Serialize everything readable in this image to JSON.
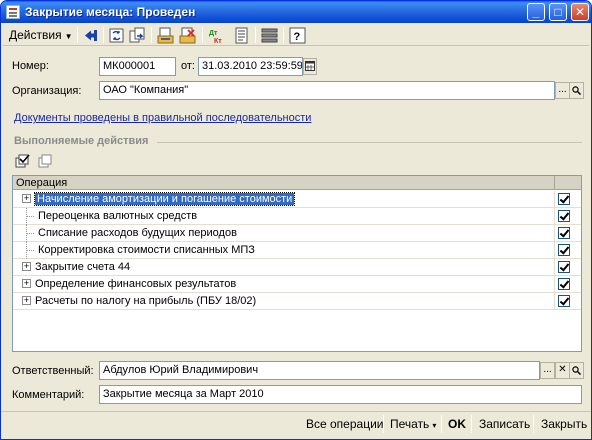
{
  "window": {
    "title": "Закрытие месяца: Проведен",
    "minimize": "_",
    "maximize": "□",
    "close": "✕"
  },
  "toolbar": {
    "actions_label": "Действия",
    "icons": [
      "back-arrow-icon",
      "refresh-icon",
      "replace-icon",
      "post-document-icon",
      "unpost-document-icon",
      "dt-kt-icon",
      "report-icon",
      "structure-icon",
      "help-icon"
    ],
    "help_symbol": "?",
    "dt_symbol": "Дт",
    "kt_symbol": "Кт"
  },
  "form": {
    "number_label": "Номер:",
    "number_value": "МК000001",
    "date_label": "от:",
    "date_value": "31.03.2010 23:59:59",
    "org_label": "Организация:",
    "org_value": "ОАО \"Компания\"",
    "sequence_link": "Документы проведены в правильной последовательности",
    "section_title": "Выполняемые действия"
  },
  "grid": {
    "header": "Операция",
    "rows": [
      {
        "label": "Начисление амортизации и погашение стоимости",
        "expandable": true,
        "level": 0,
        "checked": true,
        "selected": true
      },
      {
        "label": "Переоценка валютных средств",
        "expandable": false,
        "level": 1,
        "checked": true,
        "selected": false
      },
      {
        "label": "Списание расходов будущих периодов",
        "expandable": false,
        "level": 1,
        "checked": true,
        "selected": false
      },
      {
        "label": "Корректировка стоимости списанных МПЗ",
        "expandable": false,
        "level": 1,
        "checked": true,
        "selected": false
      },
      {
        "label": "Закрытие счета 44",
        "expandable": true,
        "level": 0,
        "checked": true,
        "selected": false
      },
      {
        "label": "Определение финансовых результатов",
        "expandable": true,
        "level": 0,
        "checked": true,
        "selected": false
      },
      {
        "label": "Расчеты по налогу на прибыль (ПБУ 18/02)",
        "expandable": true,
        "level": 0,
        "checked": true,
        "selected": false
      }
    ]
  },
  "footer_fields": {
    "responsible_label": "Ответственный:",
    "responsible_value": "Абдулов Юрий Владимирович",
    "comment_label": "Комментарий:",
    "comment_value": "Закрытие месяца за Март 2010"
  },
  "buttons": {
    "all_operations": "Все операции",
    "print": "Печать",
    "ok": "OK",
    "save": "Записать",
    "close": "Закрыть"
  },
  "symbols": {
    "ellipsis": "...",
    "magnifier": "🔍",
    "clear": "✕",
    "expand": "+",
    "dropdown": "▾"
  }
}
